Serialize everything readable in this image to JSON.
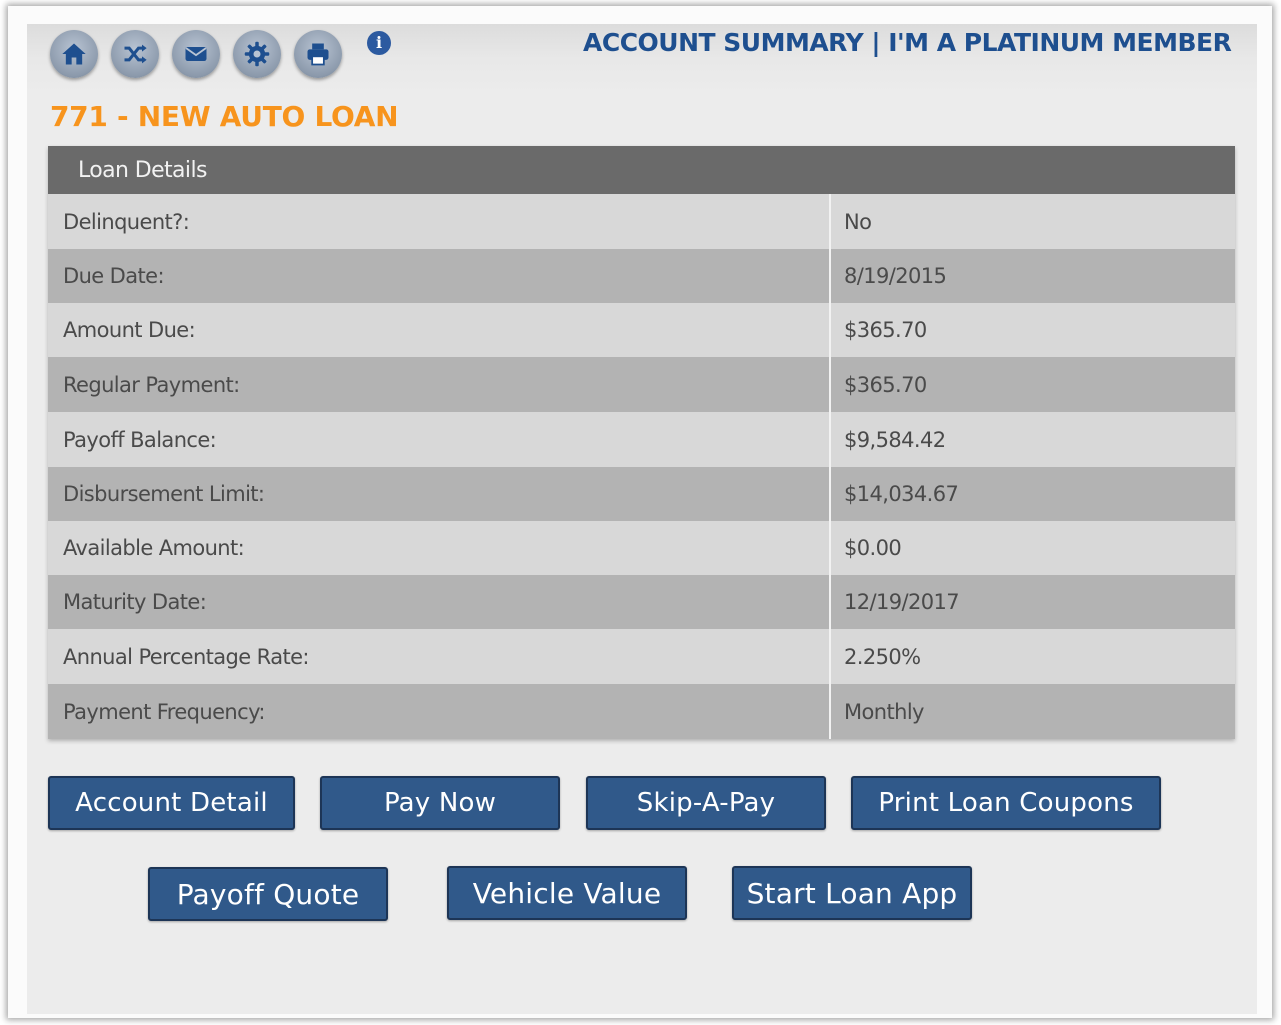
{
  "header": {
    "icons": [
      "home-icon",
      "shuffle-icon",
      "mail-icon",
      "gear-icon",
      "printer-icon",
      "info-icon"
    ],
    "info_glyph": "i",
    "account_summary": "ACCOUNT SUMMARY | I'M A PLATINUM MEMBER"
  },
  "loan": {
    "title": "771 - NEW AUTO LOAN",
    "section_header": "Loan Details",
    "rows": [
      {
        "label": "Delinquent?:",
        "value": "No"
      },
      {
        "label": "Due Date:",
        "value": "8/19/2015"
      },
      {
        "label": "Amount Due:",
        "value": "$365.70"
      },
      {
        "label": "Regular Payment:",
        "value": "$365.70"
      },
      {
        "label": "Payoff Balance:",
        "value": "$9,584.42"
      },
      {
        "label": "Disbursement Limit:",
        "value": "$14,034.67"
      },
      {
        "label": "Available Amount:",
        "value": "$0.00"
      },
      {
        "label": "Maturity Date:",
        "value": "12/19/2017"
      },
      {
        "label": "Annual Percentage Rate:",
        "value": "2.250%"
      },
      {
        "label": "Payment Frequency:",
        "value": "Monthly"
      }
    ]
  },
  "buttons": {
    "account_detail": "Account Detail",
    "pay_now": "Pay Now",
    "skip_a_pay": "Skip-A-Pay",
    "print_loan_coupons": "Print Loan Coupons",
    "payoff_quote": "Payoff Quote",
    "vehicle_value": "Vehicle Value",
    "start_loan_app": "Start Loan App"
  },
  "colors": {
    "accent_orange": "#f7941d",
    "summary_blue": "#1e4f8f",
    "button_blue": "#30598a",
    "header_gray": "#6a6a6a"
  }
}
